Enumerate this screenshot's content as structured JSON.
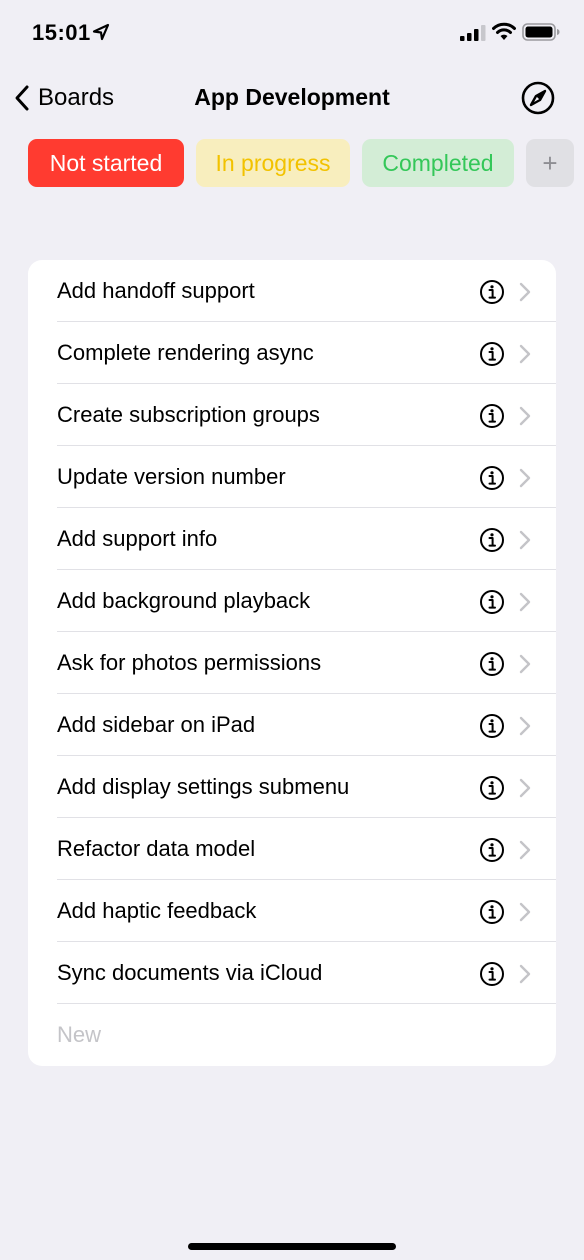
{
  "status_bar": {
    "time": "15:01"
  },
  "nav": {
    "back_label": "Boards",
    "title": "App Development",
    "right_icon": "compass-icon"
  },
  "pills": [
    {
      "label": "Not started",
      "color": "#ff3b30"
    },
    {
      "label": "In progress",
      "color": "#f2c200"
    },
    {
      "label": "Completed",
      "color": "#34c759"
    },
    {
      "label": "+"
    }
  ],
  "tasks": [
    {
      "title": "Add handoff support"
    },
    {
      "title": "Complete rendering async"
    },
    {
      "title": "Create subscription groups"
    },
    {
      "title": "Update version number"
    },
    {
      "title": "Add support info"
    },
    {
      "title": "Add background playback"
    },
    {
      "title": "Ask for photos permissions"
    },
    {
      "title": "Add sidebar on iPad"
    },
    {
      "title": "Add display settings submenu"
    },
    {
      "title": "Refactor data model"
    },
    {
      "title": "Add haptic feedback"
    },
    {
      "title": "Sync documents via iCloud"
    }
  ],
  "new_task": {
    "placeholder": "New"
  }
}
